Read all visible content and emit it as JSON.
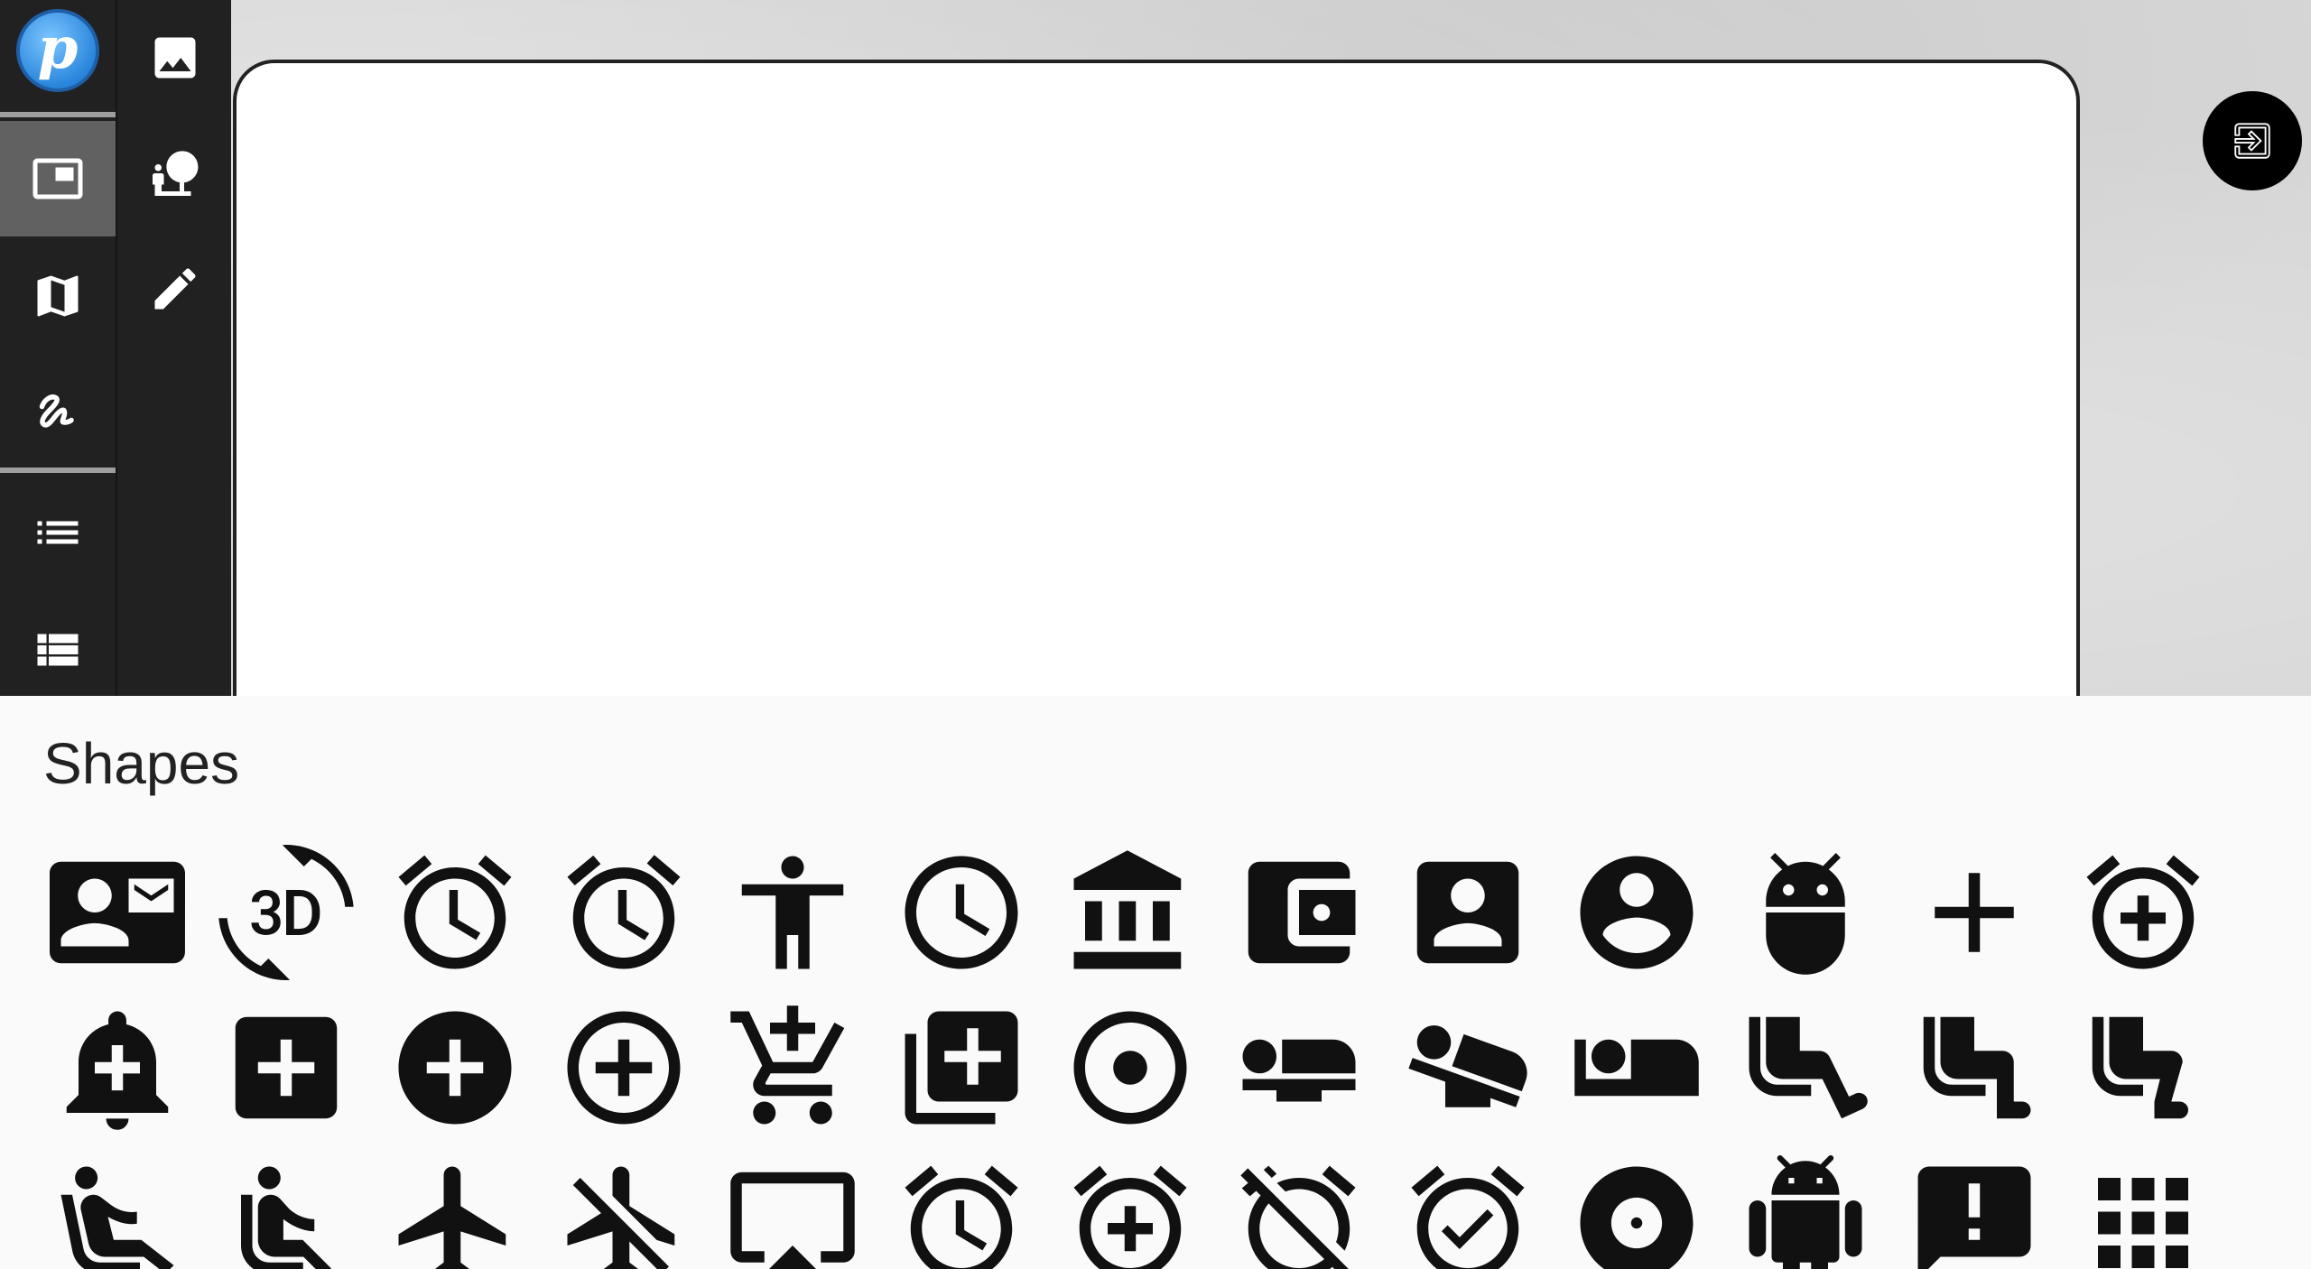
{
  "app": {
    "logo_letter": "p"
  },
  "rail": {
    "items": [
      {
        "name": "frame-icon",
        "active": true
      },
      {
        "name": "map-icon",
        "active": false
      },
      {
        "name": "signature-icon",
        "active": false
      },
      {
        "name": "list-icon",
        "active": false
      },
      {
        "name": "table-list-icon",
        "active": false
      }
    ]
  },
  "rail2": {
    "items": [
      {
        "name": "image-icon"
      },
      {
        "name": "nature-people-icon"
      },
      {
        "name": "pencil-icon"
      }
    ]
  },
  "exit_button": {
    "icon": "exit-to-app-icon"
  },
  "shapes_panel": {
    "title": "Shapes",
    "icons": [
      "contact-mail-icon",
      "3d-rotation-icon",
      "access-alarm-icon",
      "access-alarms-icon",
      "accessibility-icon",
      "access-time-icon",
      "account-balance-icon",
      "account-balance-wallet-icon",
      "account-box-icon",
      "account-circle-icon",
      "adb-icon",
      "add-icon",
      "add-alarm-icon",
      "add-alert-icon",
      "add-box-icon",
      "add-circle-icon",
      "add-circle-outline-icon",
      "add-shopping-cart-icon",
      "add-to-photos-icon",
      "adjust-icon",
      "airline-seat-flat-icon",
      "airline-seat-flat-angled-icon",
      "airline-seat-individual-suite-icon",
      "airline-seat-legroom-extra-icon",
      "airline-seat-legroom-normal-icon",
      "airline-seat-legroom-reduced-icon",
      "airline-seat-recline-extra-icon",
      "airline-seat-recline-normal-icon",
      "airplanemode-active-icon",
      "airplanemode-inactive-icon",
      "airplay-icon",
      "alarm-icon",
      "alarm-add-icon",
      "alarm-off-icon",
      "alarm-on-icon",
      "album-icon",
      "android-icon",
      "announcement-icon",
      "apps-icon"
    ]
  }
}
